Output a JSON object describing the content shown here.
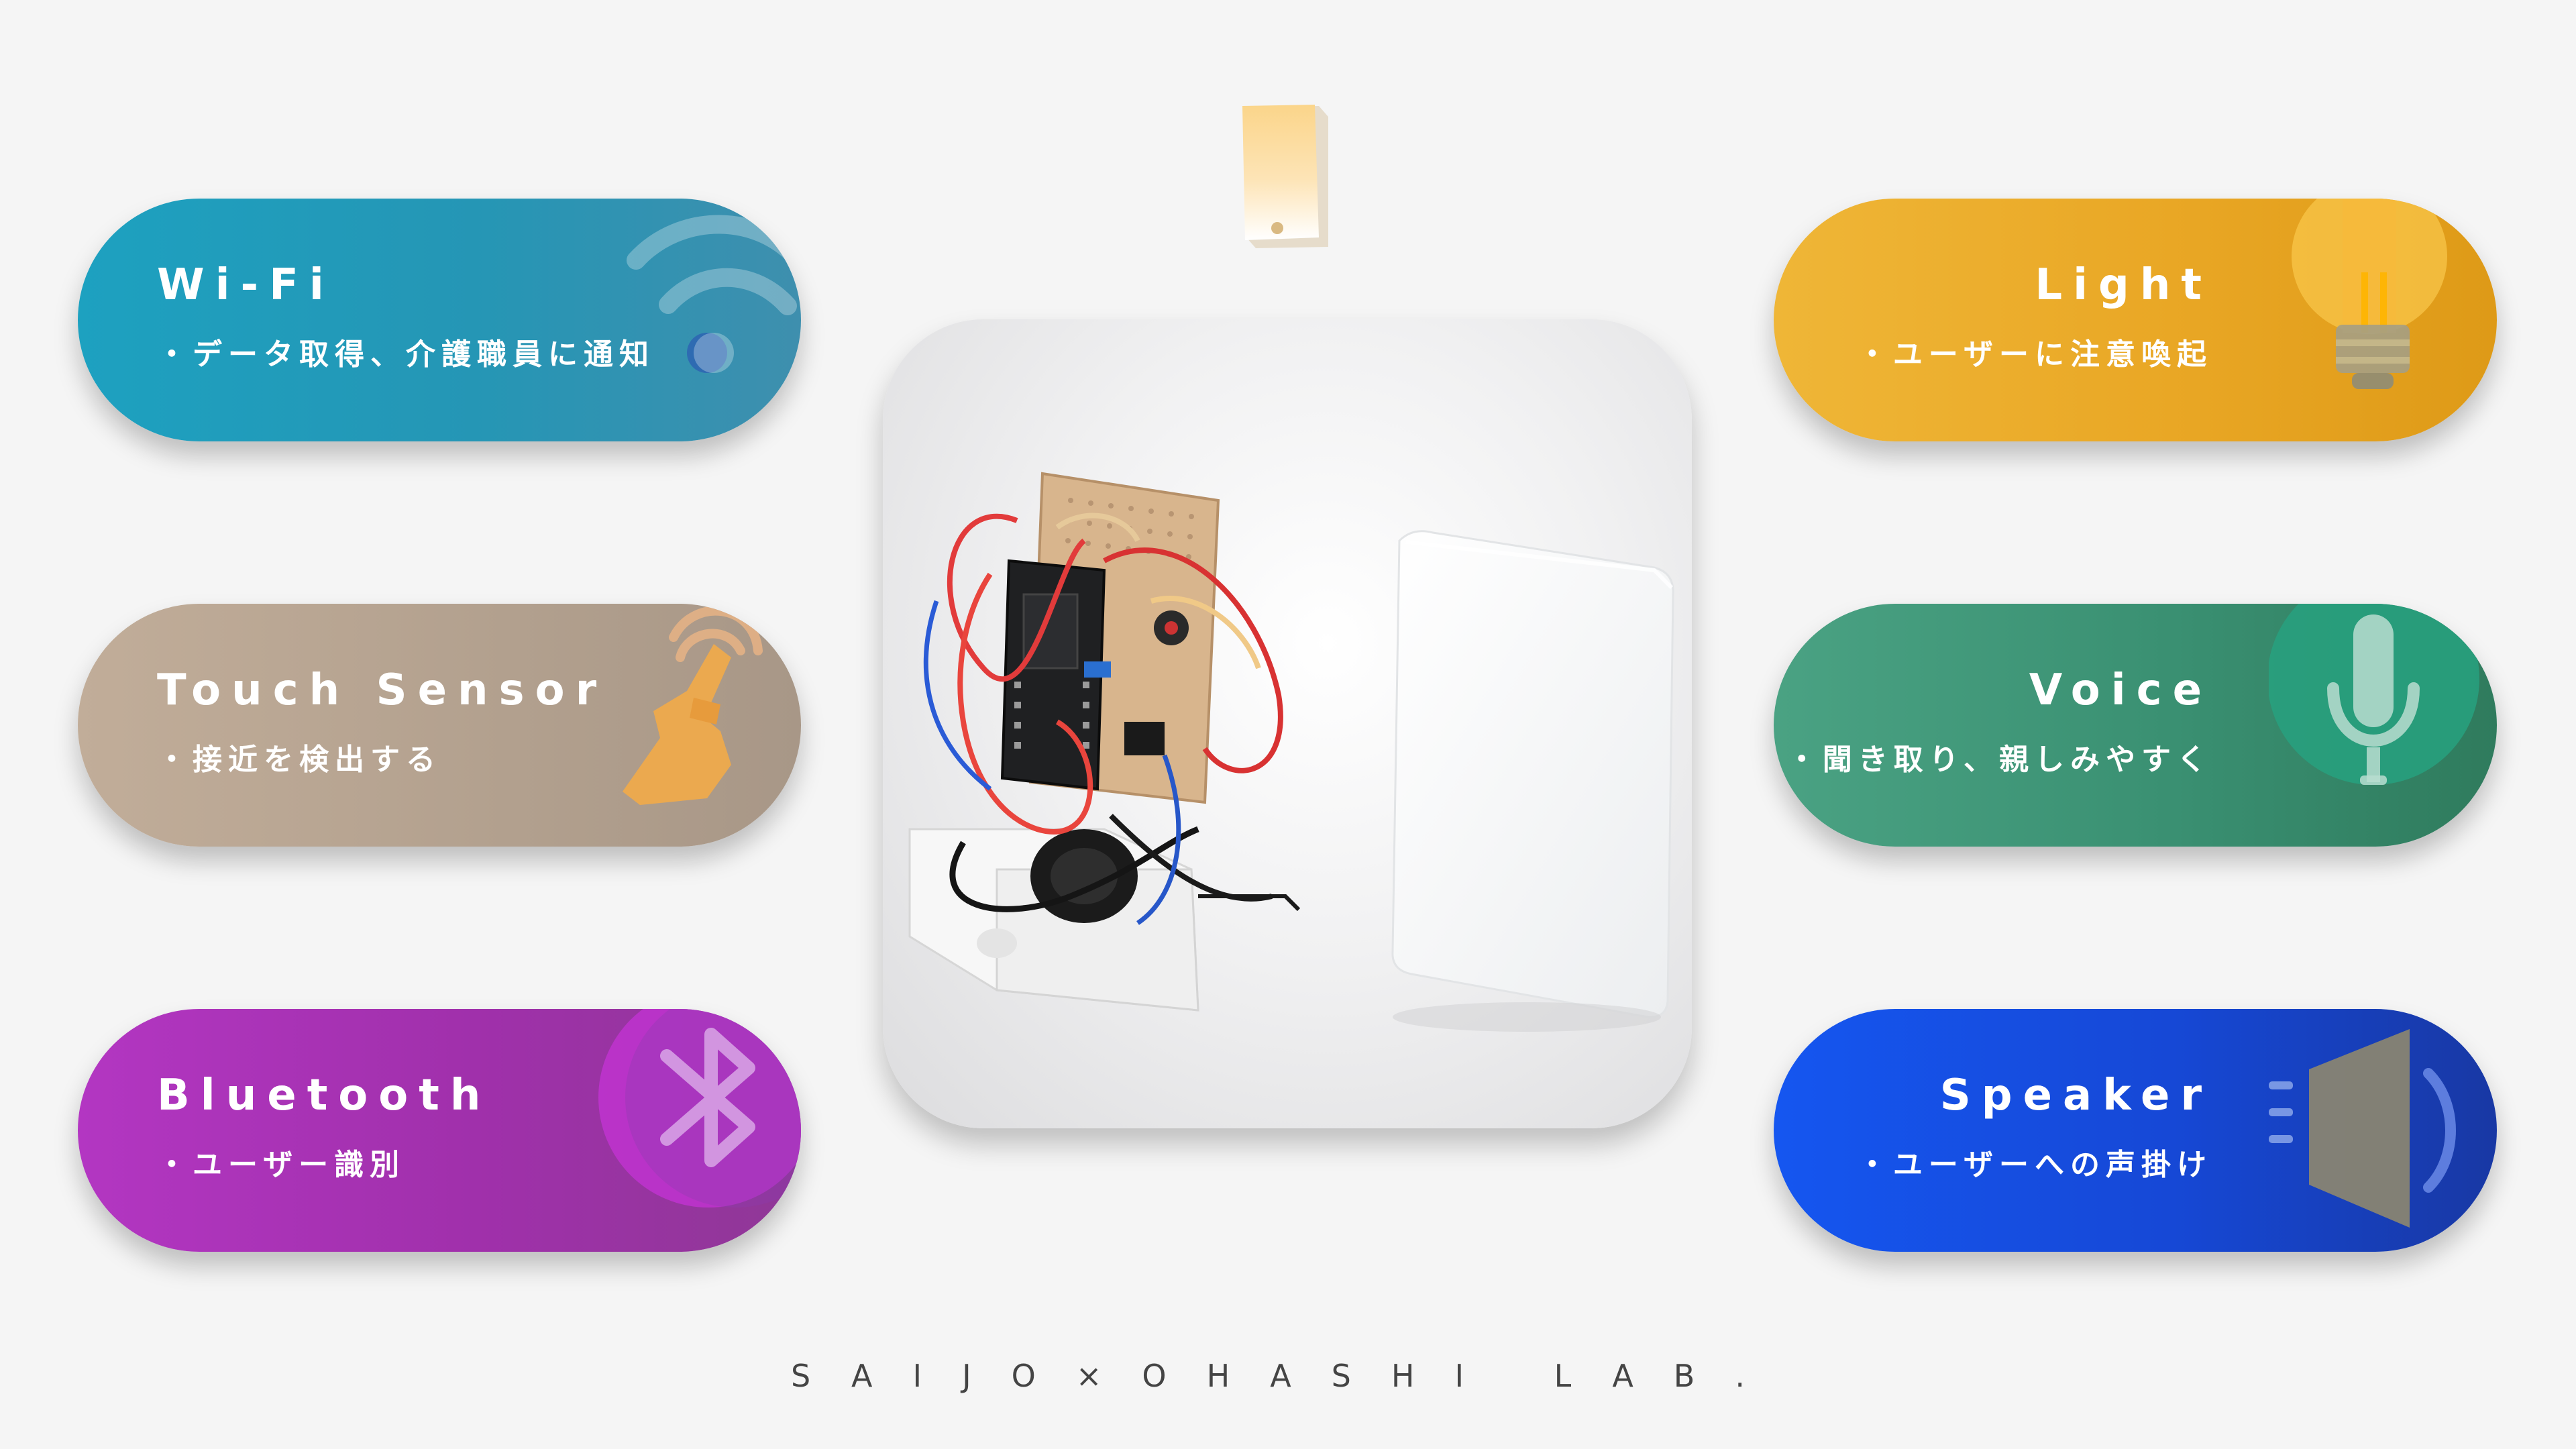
{
  "features": {
    "wifi": {
      "title": "Wi-Fi",
      "desc": "・データ取得、介護職員に通知",
      "icon": "wifi-icon",
      "color": "#1da1c0"
    },
    "touch": {
      "title": "Touch Sensor",
      "desc": "・接近を検出する",
      "icon": "touch-hand-icon",
      "color": "#b8a592"
    },
    "bluetooth": {
      "title": "Bluetooth",
      "desc": "・ユーザー識別",
      "icon": "bluetooth-icon",
      "color": "#a834b5"
    },
    "light": {
      "title": "Light",
      "desc": "・ユーザーに注意喚起",
      "icon": "light-bulb-icon",
      "color": "#eaaa28"
    },
    "voice": {
      "title": "Voice",
      "desc": "・聞き取り、親しみやすく",
      "icon": "microphone-icon",
      "color": "#3c9373"
    },
    "speaker": {
      "title": "Speaker",
      "desc": "・ユーザーへの声掛け",
      "icon": "speaker-icon",
      "color": "#1650e4"
    }
  },
  "photo": {
    "subject": "device-prototype-photo"
  },
  "footer": {
    "text": "SAIJO×OHASHI LAB."
  }
}
